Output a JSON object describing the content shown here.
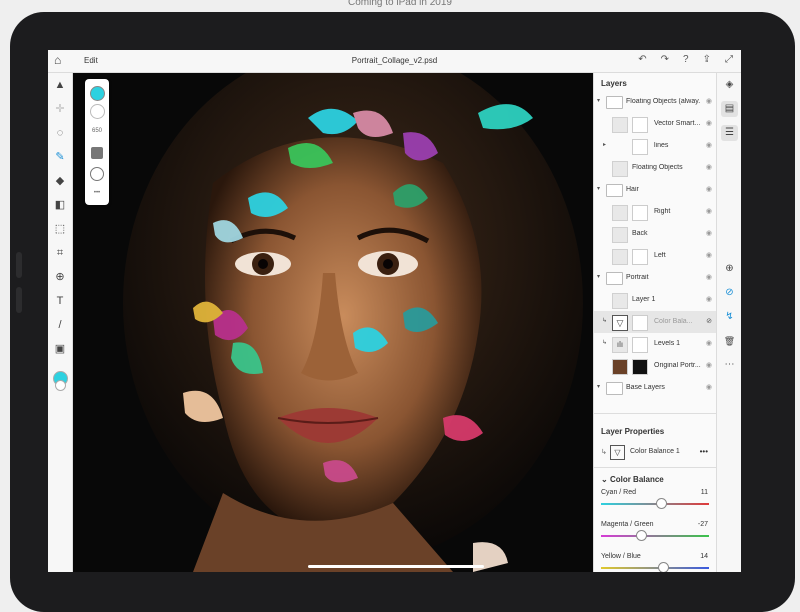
{
  "caption": "Coming to iPad in 2019",
  "topbar": {
    "edit_label": "Edit",
    "document_title": "Portrait_Collage_v2.psd",
    "home_icon": "⌂",
    "icons": [
      "↶",
      "↷",
      "?",
      "⇪",
      "⤢"
    ]
  },
  "tools": [
    "▲",
    "✛",
    "◌",
    "✎",
    "◆",
    "◧",
    "⬚",
    "⌗",
    "⊕",
    "T",
    "/",
    "▣"
  ],
  "colors": {
    "accent": "#2dd1e0",
    "selection": "#e6e6e6"
  },
  "float_panel": {
    "brush_size": "650",
    "more": "•••"
  },
  "layers": {
    "title": "Layers",
    "items": [
      {
        "name": "Floating Objects (alway...",
        "indent": 0,
        "type": "group",
        "expanded": true
      },
      {
        "name": "Vector Smart...",
        "indent": 1,
        "type": "layer"
      },
      {
        "name": "lines",
        "indent": 1,
        "type": "group",
        "expanded": false
      },
      {
        "name": "Floating Objects",
        "indent": 1,
        "type": "layer"
      },
      {
        "name": "Hair",
        "indent": 0,
        "type": "group",
        "expanded": true
      },
      {
        "name": "Right",
        "indent": 1,
        "type": "layer"
      },
      {
        "name": "Back",
        "indent": 1,
        "type": "layer"
      },
      {
        "name": "Left",
        "indent": 1,
        "type": "layer"
      },
      {
        "name": "Portrait",
        "indent": 0,
        "type": "group",
        "expanded": true
      },
      {
        "name": "Layer 1",
        "indent": 1,
        "type": "layer"
      },
      {
        "name": "Color Bala...",
        "indent": 1,
        "type": "adjustment",
        "selected": true
      },
      {
        "name": "Levels 1",
        "indent": 1,
        "type": "adjustment"
      },
      {
        "name": "Original Portr...",
        "indent": 1,
        "type": "image"
      },
      {
        "name": "Base Layers",
        "indent": 0,
        "type": "group",
        "expanded": true
      }
    ]
  },
  "layer_properties": {
    "title": "Layer Properties",
    "layer_name": "Color Balance 1",
    "more": "•••"
  },
  "color_balance": {
    "title": "Color Balance",
    "sliders": [
      {
        "label": "Cyan / Red",
        "value": "11",
        "fraction": 0.56,
        "from": "#2dd1e0",
        "to": "#e03a3a"
      },
      {
        "label": "Magenta / Green",
        "value": "-27",
        "fraction": 0.37,
        "from": "#d63bd6",
        "to": "#3ac44a"
      },
      {
        "label": "Yellow / Blue",
        "value": "14",
        "fraction": 0.57,
        "from": "#e0c92d",
        "to": "#3a5ae0"
      }
    ]
  },
  "rail_icons": [
    "◈",
    "▤",
    "☰",
    "⊕",
    "⊘",
    "↯",
    "🗑",
    "⋯"
  ]
}
